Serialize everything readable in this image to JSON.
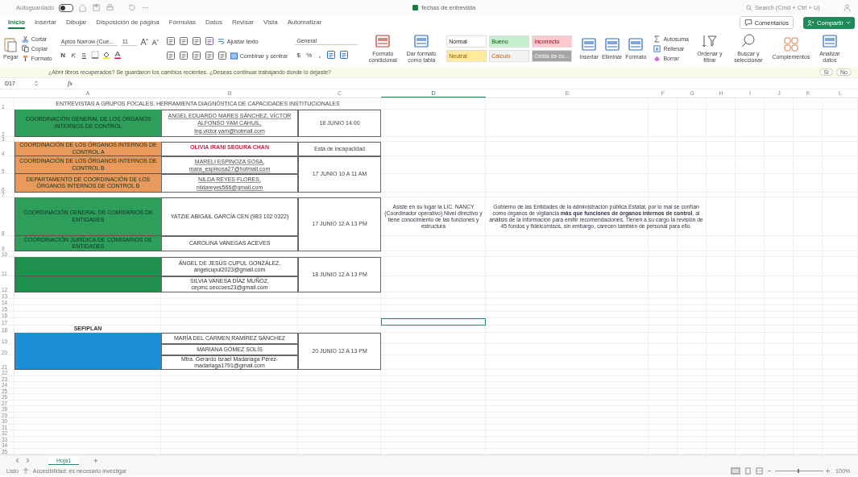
{
  "title_bar": {
    "autosave_label": "Autoguardado",
    "autosave_on": false,
    "title": "fechas de entrevista",
    "search_placeholder": "Search (Cmd + Ctrl + U)"
  },
  "menu_tabs": [
    {
      "label": "Inicio",
      "selected": true
    },
    {
      "label": "Insertar",
      "selected": false
    },
    {
      "label": "Dibujar",
      "selected": false
    },
    {
      "label": "Disposición de página",
      "selected": false
    },
    {
      "label": "Fórmulas",
      "selected": false
    },
    {
      "label": "Datos",
      "selected": false
    },
    {
      "label": "Revisar",
      "selected": false
    },
    {
      "label": "Vista",
      "selected": false
    },
    {
      "label": "Automatizar",
      "selected": false
    }
  ],
  "comments_button": "Comentarios",
  "share_button": "Compartir",
  "ribbon": {
    "clipboard": {
      "paste": "Pegar",
      "cut": "Cortar",
      "copy": "Copiar",
      "format": "Formato"
    },
    "font": {
      "name": "Aptos Narrow (Cue...",
      "size": "11",
      "bold": "N",
      "italic": "K",
      "underline": "S"
    },
    "alignment": {
      "wrap": "Ajustar texto",
      "merge": "Combinar y centrar"
    },
    "number": {
      "format": "General",
      "currency": "$",
      "percent": "%",
      "thousands": ","
    },
    "table": {
      "conditional": "Formato condicional",
      "as_table": "Dar formato como tabla"
    },
    "styles": [
      {
        "label": "Normal",
        "color": "#ffffff"
      },
      {
        "label": "Bueno",
        "color": "#c6efce"
      },
      {
        "label": "Incorrecto",
        "color": "#ffc7ce"
      },
      {
        "label": "Neutral",
        "color": "#ffeb9c"
      },
      {
        "label": "Cálculo",
        "color": "#f2f2f2"
      },
      {
        "label": "Celda de co...",
        "color": "#a5a5a5"
      }
    ],
    "cells": {
      "insert": "Insertar",
      "delete": "Eliminar",
      "format": "Formato"
    },
    "editing": {
      "autosum": "Autosuma",
      "fill": "Rellenar",
      "clear": "Borrar",
      "sort": "Ordenar y filtrar",
      "find": "Buscar y seleccionar"
    },
    "addins": "Complementos",
    "analyze": "Analizar datos"
  },
  "notification": {
    "message": "¿Abrir libros recuperados?  Se guardaron los cambios recientes. ¿Deseas continuar trabajando donde lo dejaste?",
    "yes": "Sí",
    "no": "No"
  },
  "formula_bar": {
    "name_box": "D17",
    "fx": "fx"
  },
  "columns": [
    {
      "label": "A",
      "selected": false
    },
    {
      "label": "B",
      "selected": false
    },
    {
      "label": "C",
      "selected": false
    },
    {
      "label": "D",
      "selected": true
    },
    {
      "label": "E",
      "selected": false
    },
    {
      "label": "F",
      "selected": false
    },
    {
      "label": "G",
      "selected": false
    },
    {
      "label": "H",
      "selected": false
    },
    {
      "label": "I",
      "selected": false
    },
    {
      "label": "J",
      "selected": false
    },
    {
      "label": "K",
      "selected": false
    },
    {
      "label": "L",
      "selected": false
    }
  ],
  "row_headers": [
    "1",
    "2",
    "3",
    "4",
    "5",
    "6",
    "7",
    "8",
    "9",
    "10",
    "11",
    "12",
    "13",
    "14",
    "15",
    "16",
    "17",
    "18",
    "19",
    "20",
    "21",
    "22",
    "23",
    "24",
    "25",
    "26",
    "27",
    "28",
    "29",
    "30",
    "31",
    "32",
    "33",
    "34",
    "35"
  ],
  "cells": [
    {
      "kind": "title",
      "text": "ENTREVISTAS A GRUPOS FOCALES. HERRAMIENTA DIAGNÓSTICA DE CAPACIDADES INSTITUCIONALES"
    },
    {
      "kind": "unit",
      "color": "#2e9e5b",
      "text": "COORDINACIÓN GENERAL DE LOS ÓRGANOS INTERNOS DE CONTROL"
    },
    {
      "kind": "link",
      "text": "ANGEL EDUARDO MARES SÁNCHEZ, VÍCTOR ALFONSO YAM CAHUIL, ing.victor.yam@hotmail.com"
    },
    {
      "kind": "date",
      "text": "18 JUNIO 14:00"
    },
    {
      "kind": "unit",
      "color": "#e89a5c",
      "text": "COORDINACIÓN DE LOS ÓRGANOS INTERNOS DE CONTROL A"
    },
    {
      "kind": "alert",
      "text": "OLIVIA IRANI SEGURA CHAN"
    },
    {
      "kind": "date",
      "text": "Está de incapacidad"
    },
    {
      "kind": "unit",
      "color": "#e89a5c",
      "text": "COORDINACIÓN DE LOS ÓRGANOS INTERNOS DE CONTROL B"
    },
    {
      "kind": "link",
      "text": "MARELI ESPINOZA SOSA, mara_espinosa27@hotmail.com"
    },
    {
      "kind": "date",
      "text": "17 JUNIO 10 A 11 AM"
    },
    {
      "kind": "unit",
      "color": "#e89a5c",
      "text": "DEPARTAMENTO DE COORDINACIÓN DE LOS ÓRGANOS INTERNOS DE CONTROL B"
    },
    {
      "kind": "link",
      "text": "NILDA REYES FLORES, nildareyes566@gmail.com"
    },
    {
      "kind": "unit",
      "color": "#2e9e5b",
      "text": "COORDINACIÓN GENERAL DE COMISARIOS DE ENTIDADES"
    },
    {
      "kind": "name",
      "text": "YATZIE ABIGAIL GARCÍA CEN (983 102 0322)"
    },
    {
      "kind": "date",
      "text": "17 JUNIO 12 A 13 PM"
    },
    {
      "kind": "note",
      "text": "Asiste en su lugar la LIC. NANCY (Coordinador operativo) Nivel directivo y tiene conocimiento de las funciones y estructura"
    },
    {
      "kind": "note",
      "text": "Gobierno de las Entidades de la administración pública Estatal, por lo mal se confían como órganos de vigilancia **más que funciones de órganos internos de control**, al análisis de la información para emitir recomendaciones. Tienen a su cargo la revisión de 45 fondos y fideicomisos, sin embargo, carecen también de personal para ello."
    },
    {
      "kind": "unit",
      "color": "#2e9e5b",
      "text": "COORDINACIÓN JURÍDICA DE COMISARIOS DE ENTIDADES"
    },
    {
      "kind": "name",
      "text": "CAROLINA VANEGAS ACEVES"
    },
    {
      "kind": "unit",
      "color": "#1f8f4e"
    },
    {
      "kind": "name",
      "text": "ÁNGEL DE JESÚS CUPUL GONZÁLEZ, angelcupul2023@gmail.com"
    },
    {
      "kind": "date",
      "text": "18 JUNIO 12 A 13 PM"
    },
    {
      "kind": "unit",
      "color": "#1f8f4e"
    },
    {
      "kind": "name",
      "text": "SILVIA VANESA DÍAZ MUÑOZ, cepmc.seccoes23@gmail.com"
    },
    {
      "kind": "section",
      "text": "SEFIPLAN"
    },
    {
      "kind": "unit",
      "color": "#1a8fd6"
    },
    {
      "kind": "name",
      "text": "MARÍA DEL CARMEN RAMÍREZ SÁNCHEZ"
    },
    {
      "kind": "name",
      "text": "MARIANA GÓMEZ SOLÍS"
    },
    {
      "kind": "name",
      "text": "Mtra. Gerardo Israel Madariaga Pérez- madariaga1791@gmail.com"
    },
    {
      "kind": "date",
      "text": "20 JUNIO 12 A 13 PM"
    }
  ],
  "sheet_tabs": [
    {
      "label": "Hoja1",
      "selected": true
    }
  ],
  "add_sheet": "+",
  "status_bar": {
    "status": "Listo",
    "accessibility": "Accesibilidad: es necesario investigar",
    "zoom": "100%"
  }
}
